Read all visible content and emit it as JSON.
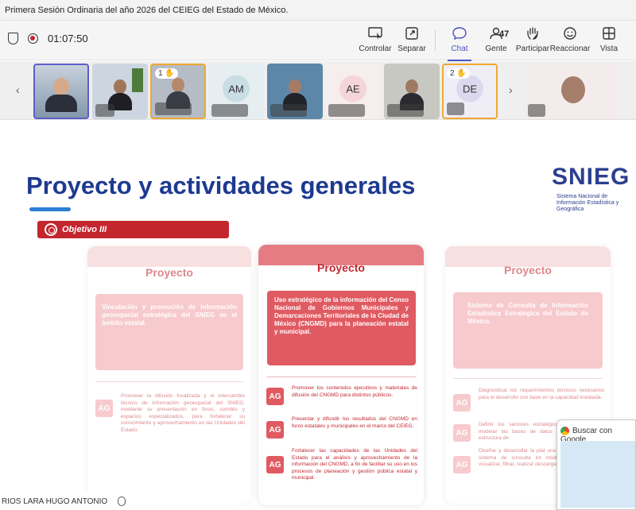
{
  "window": {
    "title": "Primera Sesión Ordinaria del año 2026 del CEIEG del Estado de México."
  },
  "meeting": {
    "timer": "01:07:50"
  },
  "toolbar": {
    "controlar": "Controlar",
    "separar": "Separar",
    "chat": "Chat",
    "gente": "Gente",
    "gente_count": "47",
    "participar": "Participar",
    "reaccionar": "Reaccionar",
    "vista": "Vista"
  },
  "participants": [
    {
      "initials": "",
      "raised_hand": ""
    },
    {
      "initials": "",
      "raised_hand": ""
    },
    {
      "initials": "",
      "raised_hand": "1"
    },
    {
      "initials": "AM",
      "raised_hand": ""
    },
    {
      "initials": "",
      "raised_hand": ""
    },
    {
      "initials": "AE",
      "raised_hand": ""
    },
    {
      "initials": "",
      "raised_hand": ""
    },
    {
      "initials": "DE",
      "raised_hand": "2"
    },
    {
      "initials": "",
      "raised_hand": ""
    }
  ],
  "slide": {
    "title": "Proyecto y actividades generales",
    "logo_text": "SNIEG",
    "logo_subtitle": "Sistema Nacional de Información Estadística y Geográfica",
    "objective": "Objetivo III",
    "cards": [
      {
        "title": "Proyecto",
        "description": "Vinculación y promoción de información geoespacial estratégica del SNIEG en el ámbito estatal.",
        "activities": [
          {
            "tag": "AG",
            "text": "Promover la difusión focalizada y el intercambio técnico de información geoespacial del SNIEG, mediante su presentación en foros, comités y espacios especializados, para fortalecer su conocimiento y aprovechamiento en las Unidades del Estado."
          }
        ]
      },
      {
        "title": "Proyecto",
        "description": "Uso estratégico de la información del Censo Nacional de Gobiernos Municipales y Demarcaciones Territoriales de la Ciudad de México (CNGMD) para la planeación estatal y municipal.",
        "activities": [
          {
            "tag": "AG",
            "text": "Promover los contenidos ejecutivos y materiales de difusión del CNGMD para distintos públicos."
          },
          {
            "tag": "AG",
            "text": "Presentar y difundir los resultados del CNGMD en foros estatales y municipales en el marco del CEIEG."
          },
          {
            "tag": "AG",
            "text": "Fortalecer las capacidades de las Unidades del Estado para el análisis y aprovechamiento de la información del CNGMD, a fin de facilitar su uso en los procesos de planeación y gestión pública estatal y municipal."
          }
        ]
      },
      {
        "title": "Proyecto",
        "description": "Sistema de Consulta de Información Estadística Estratégica del Estado de México.",
        "activities": [
          {
            "tag": "AG",
            "text": "Diagnosticar los requerimientos técnicos necesarios para el desarrollo con base en la capacidad instalada."
          },
          {
            "tag": "AG",
            "text": "Definir los sectores estratégicos prioritarios para modelar las bases de datos y homogeneizar la estructura de"
          },
          {
            "tag": "AG",
            "text": "Diseñar y desarrollar la plat una estructura funcional sistema de consulta int módulos de informació visualizar, filtrar, realizar descargar series de datos."
          }
        ]
      }
    ]
  },
  "speaker_name": "RIOS LARA HUGO ANTONIO",
  "popup": {
    "label": "Buscar con Google"
  }
}
